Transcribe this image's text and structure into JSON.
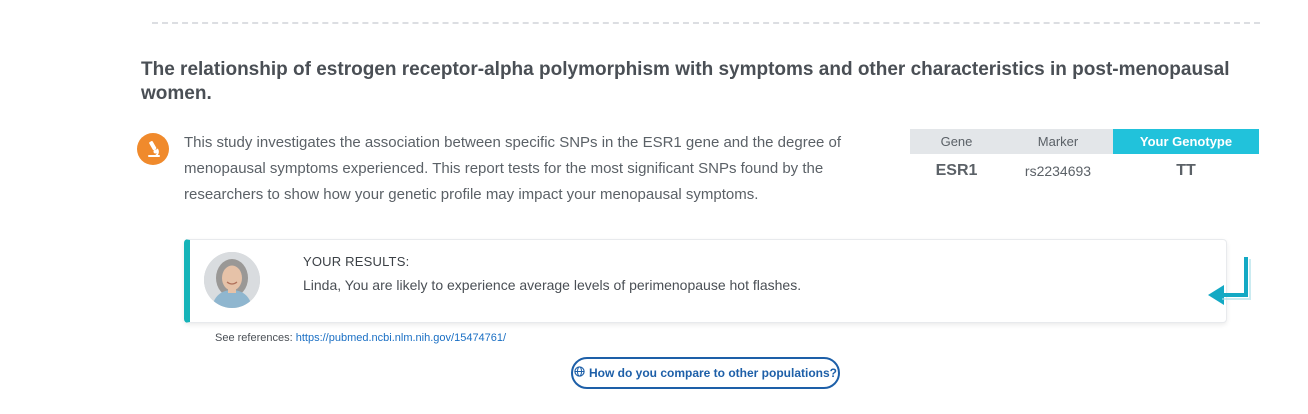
{
  "study": {
    "title": "The relationship of estrogen receptor-alpha polymorphism with symptoms and other characteristics in post-menopausal women.",
    "description": "This study investigates the association between specific SNPs in the ESR1 gene and the degree of menopausal symptoms experienced. This report tests for the most significant SNPs found by the researchers to show how your genetic profile may impact your menopausal symptoms.",
    "icon": "microscope-icon"
  },
  "genotype_table": {
    "headers": {
      "gene": "Gene",
      "marker": "Marker",
      "genotype": "Your Genotype"
    },
    "rows": [
      {
        "gene": "ESR1",
        "marker": "rs2234693",
        "genotype": "TT"
      }
    ]
  },
  "result": {
    "label": "YOUR RESULTS:",
    "text": "Linda, You are likely to experience average levels of perimenopause hot flashes.",
    "accent_color": "#15b3b8"
  },
  "references": {
    "prefix": "See references:",
    "link_text": "https://pubmed.ncbi.nlm.nih.gov/15474761/"
  },
  "compare_button": {
    "icon": "globe-icon",
    "label": "How do you compare to other populations?"
  },
  "colors": {
    "icon_orange": "#f08a2c",
    "header_teal": "#21c2db",
    "button_blue": "#1d5fa8",
    "link_blue": "#1a6fc4"
  }
}
